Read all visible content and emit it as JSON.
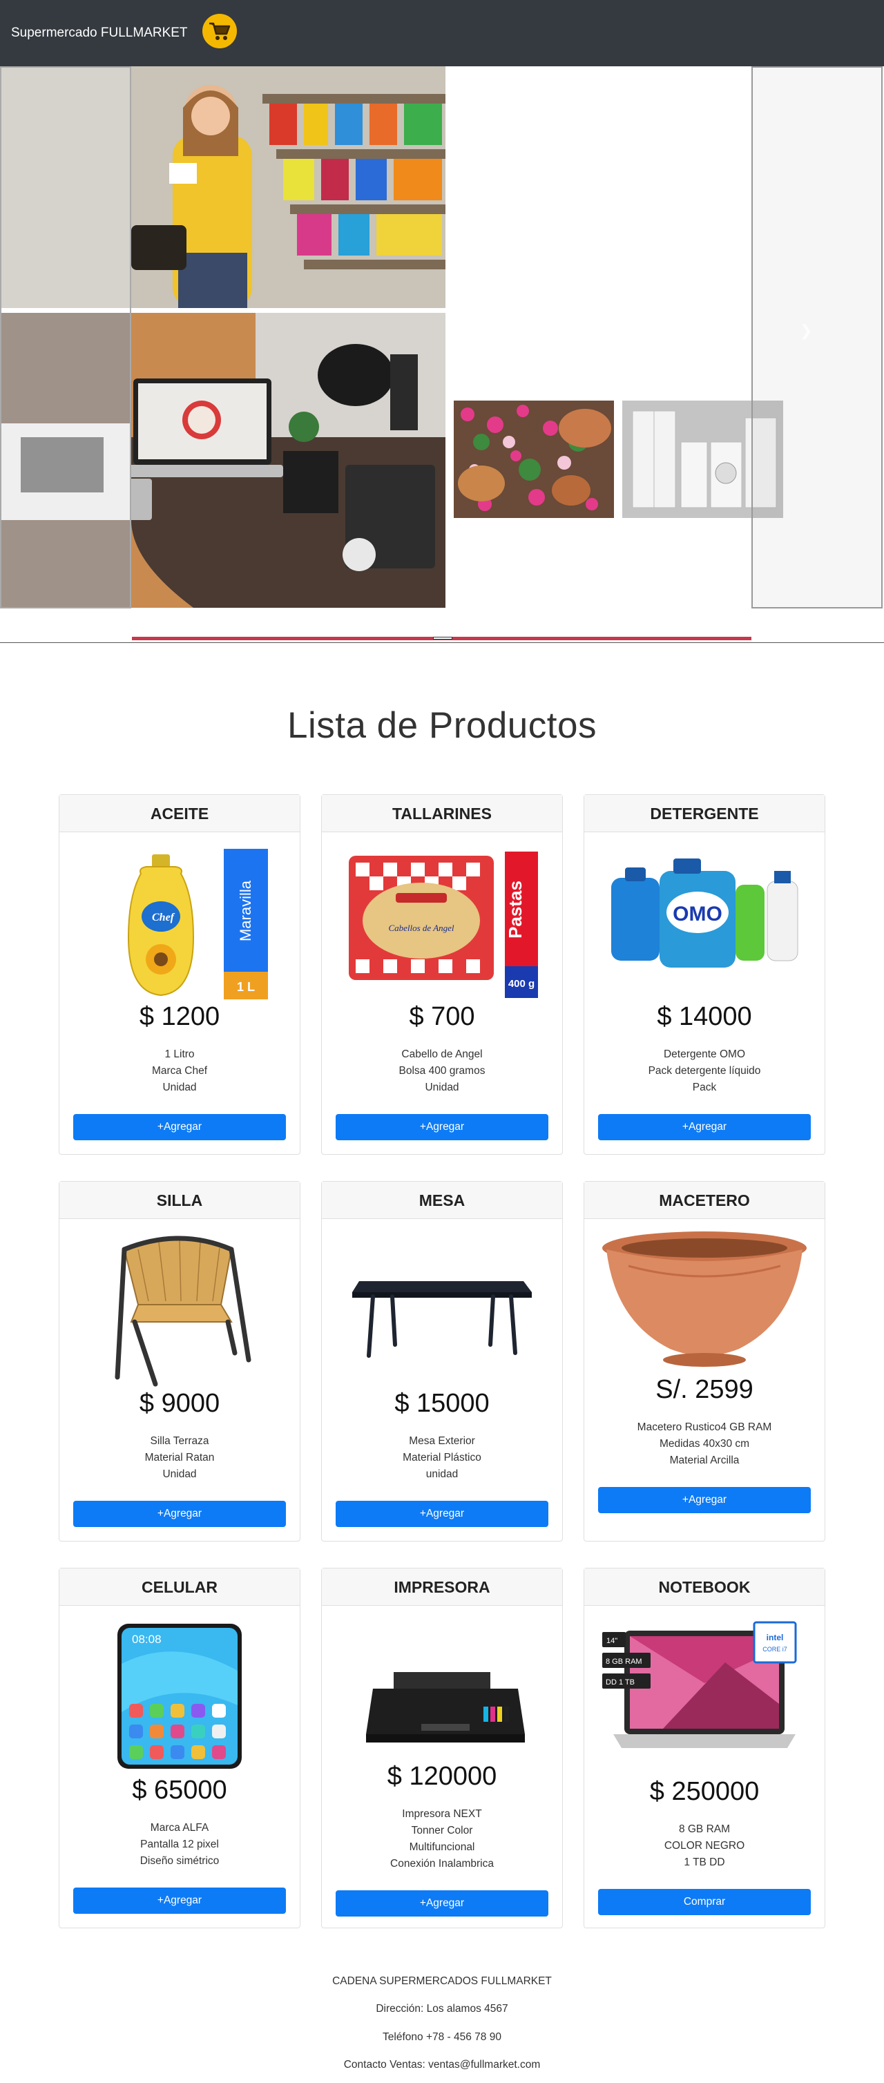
{
  "navbar": {
    "brand": "Supermercado FULLMARKET",
    "logo_icon": "shopping-cart-icon",
    "logo_color": "#f5b800"
  },
  "carousel": {
    "next_icon": "chevron-right-icon",
    "indicator_color": "#c8374a"
  },
  "section": {
    "title": "Lista de Productos"
  },
  "products": [
    {
      "name": "ACEITE",
      "price": "$ 1200",
      "desc": [
        "1 Litro",
        "Marca Chef",
        "Unidad"
      ],
      "button": "+Agregar",
      "label_text": "Maravilla",
      "badge": "1 L"
    },
    {
      "name": "TALLARINES",
      "price": "$ 700",
      "desc": [
        "Cabello de Angel",
        "Bolsa 400 gramos",
        "Unidad"
      ],
      "button": "+Agregar",
      "label_text": "Pastas",
      "badge": "400 g"
    },
    {
      "name": "DETERGENTE",
      "price": "$ 14000",
      "desc": [
        "Detergente OMO",
        "Pack detergente líquido",
        "Pack"
      ],
      "button": "+Agregar",
      "label_text": "OMO"
    },
    {
      "name": "SILLA",
      "price": "$ 9000",
      "desc": [
        "Silla Terraza",
        "Material Ratan",
        "Unidad"
      ],
      "button": "+Agregar"
    },
    {
      "name": "MESA",
      "price": "$ 15000",
      "desc": [
        "Mesa Exterior",
        "Material Plástico",
        "unidad"
      ],
      "button": "+Agregar"
    },
    {
      "name": "MACETERO",
      "price": "S/. 2599",
      "desc": [
        "Macetero Rustico4 GB RAM",
        "Medidas 40x30 cm",
        "Material Arcilla"
      ],
      "button": "+Agregar"
    },
    {
      "name": "CELULAR",
      "price": "$ 65000",
      "desc": [
        "Marca ALFA",
        "Pantalla 12 pixel",
        "Diseño simétrico"
      ],
      "button": "+Agregar",
      "screen_time": "08:08"
    },
    {
      "name": "IMPRESORA",
      "price": "$ 120000",
      "desc": [
        "Impresora NEXT",
        "Tonner Color",
        "Multifuncional",
        "Conexión Inalambrica"
      ],
      "button": "+Agregar"
    },
    {
      "name": "NOTEBOOK",
      "price": "$ 250000",
      "desc": [
        "8 GB RAM",
        "COLOR NEGRO",
        "1 TB DD"
      ],
      "button": "Comprar",
      "tags": [
        "14\"",
        "8 GB RAM",
        "DD 1 TB"
      ],
      "chip": "CORE i7"
    }
  ],
  "footer": {
    "company": "CADENA SUPERMERCADOS FULLMARKET",
    "address": "Dirección: Los alamos 4567",
    "phone": "Teléfono +78 - 456 78 90",
    "contact": "Contacto Ventas: ventas@fullmarket.com"
  }
}
